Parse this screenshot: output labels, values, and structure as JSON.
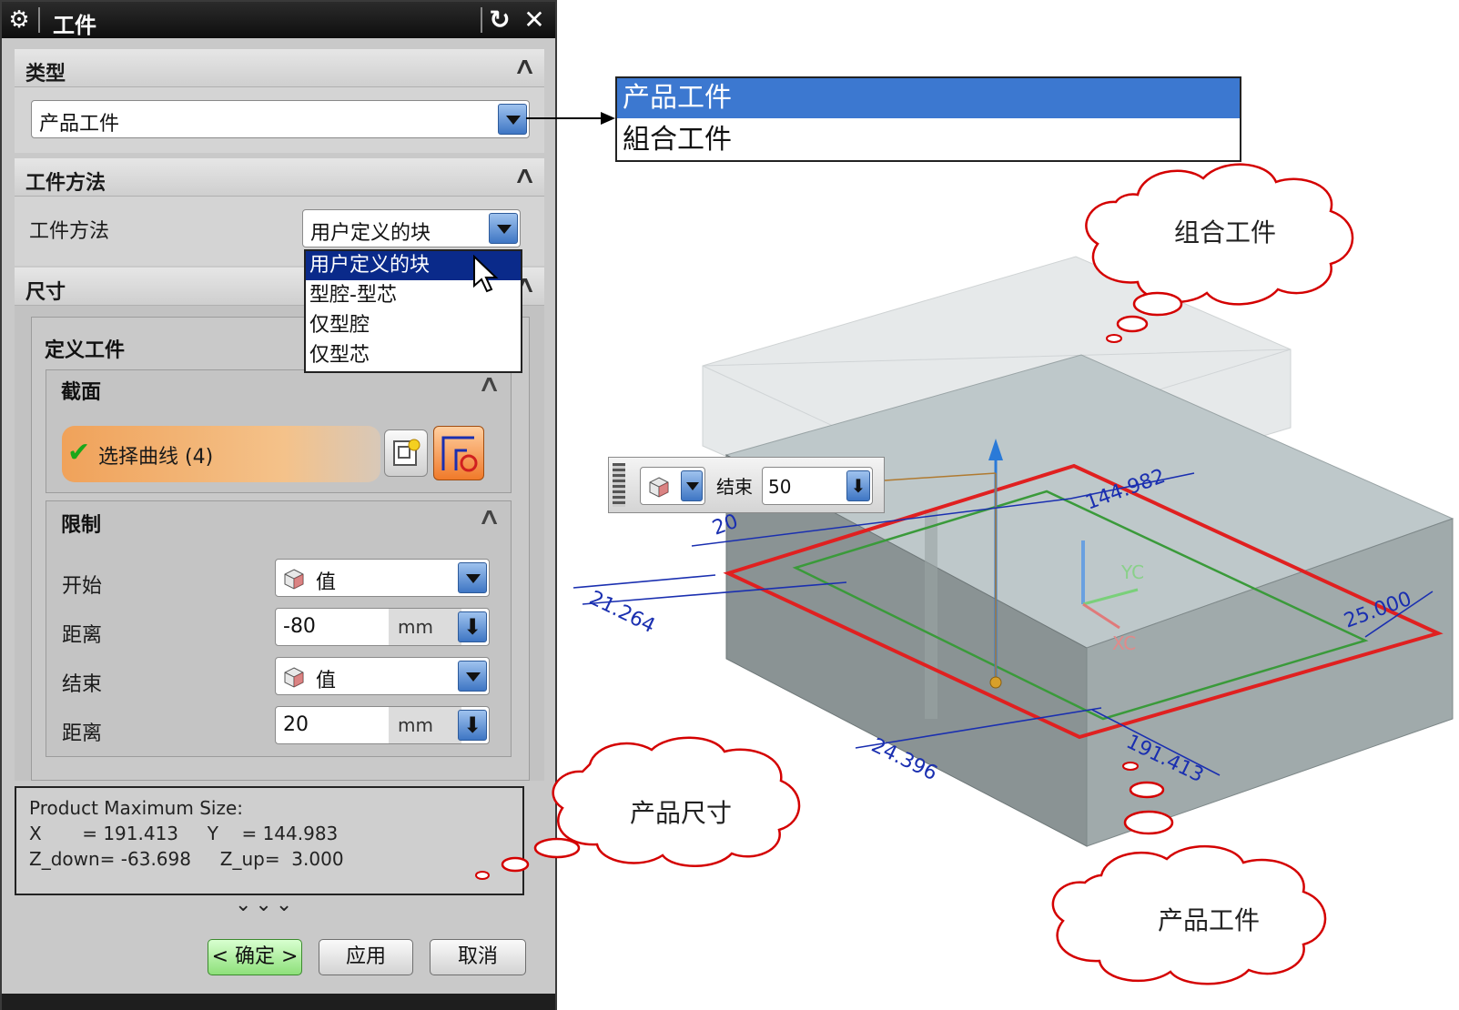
{
  "dialog": {
    "title": "工件",
    "sections": {
      "type": {
        "label": "类型",
        "value": "产品工件"
      },
      "method": {
        "label": "工件方法",
        "field_label": "工件方法",
        "value": "用户定义的块",
        "options": [
          "用户定义的块",
          "型腔-型芯",
          "仅型腔",
          "仅型芯"
        ]
      },
      "size": {
        "label": "尺寸",
        "define_label": "定义工件"
      },
      "section": {
        "label": "截面",
        "select_curve": "选择曲线 (4)"
      },
      "limits": {
        "label": "限制",
        "start_label": "开始",
        "start_value": "值",
        "start_dist_label": "距离",
        "start_dist": "-80",
        "start_unit": "mm",
        "end_label": "结束",
        "end_value": "值",
        "end_dist_label": "距离",
        "end_dist": "20",
        "end_unit": "mm"
      }
    },
    "info": {
      "line1": "Product Maximum Size:",
      "line2": "X       = 191.413     Y    = 144.983",
      "line3": "Z_down= -63.698     Z_up=  3.000"
    },
    "more": "⌄⌄⌄",
    "buttons": {
      "ok": "< 确定 >",
      "apply": "应用",
      "cancel": "取消"
    }
  },
  "type_popup": {
    "options": [
      "产品工件",
      "組合工件"
    ]
  },
  "float_bar": {
    "label": "结束",
    "value": "50"
  },
  "callouts": {
    "combo": "组合工件",
    "size": "产品尺寸",
    "product": "产品工件"
  },
  "dimensions": {
    "d1": "144.982",
    "d2": "25.000",
    "d3": "191.413",
    "d4": "21.264",
    "d5": "24.396",
    "d6": "20",
    "axis_y": "YC",
    "axis_x": "XC"
  },
  "colors": {
    "accent_blue": "#3c78d0",
    "cloud_red": "#d40000",
    "workpiece_outline": "#e02020",
    "product_outline": "#3a9a3a",
    "dimension_blue": "#1a2fb0"
  }
}
